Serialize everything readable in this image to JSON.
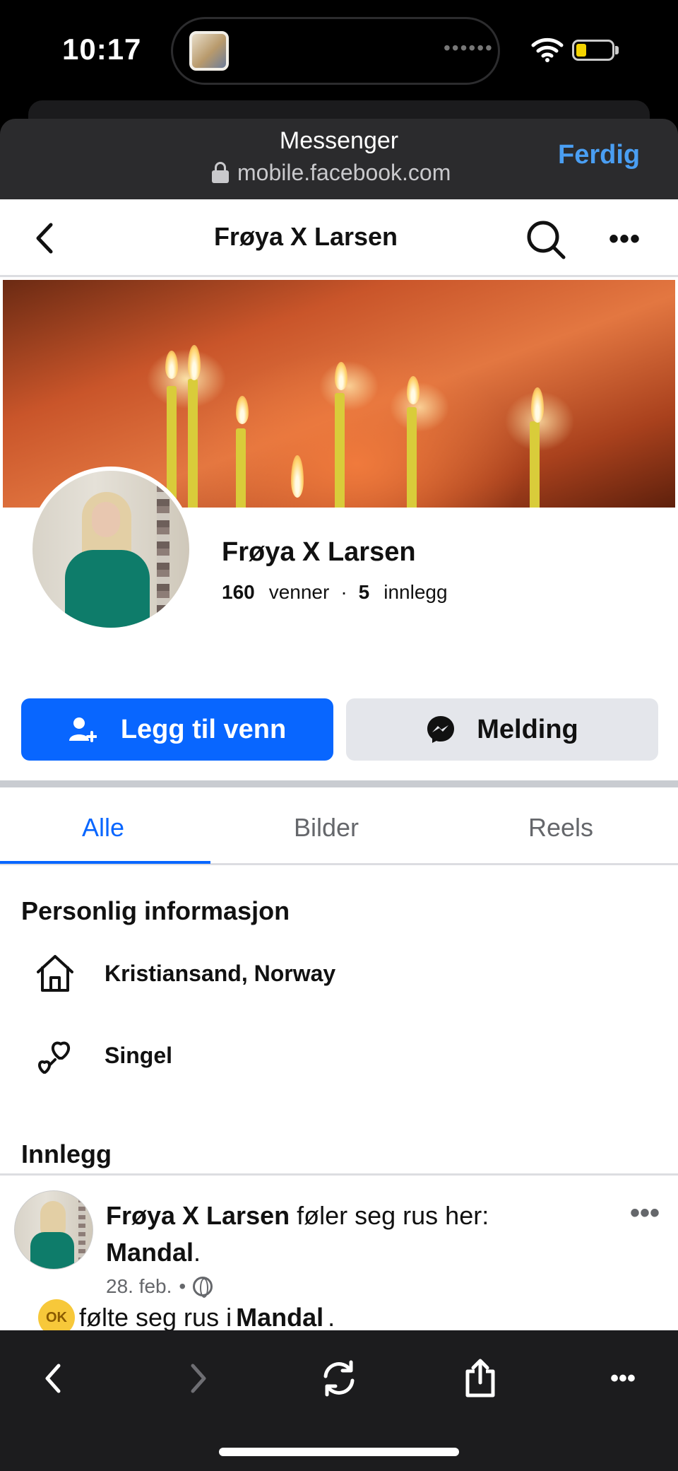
{
  "status_bar": {
    "time": "10:17"
  },
  "browser": {
    "title": "Messenger",
    "url": "mobile.facebook.com",
    "done_label": "Ferdig"
  },
  "nav": {
    "title": "Frøya X Larsen"
  },
  "profile": {
    "name": "Frøya X Larsen",
    "friends_count": "160",
    "friends_label": "venner",
    "separator": "·",
    "posts_count": "5",
    "posts_label": "innlegg"
  },
  "actions": {
    "add_friend_label": "Legg til venn",
    "message_label": "Melding"
  },
  "tabs": [
    {
      "label": "Alle",
      "active": true
    },
    {
      "label": "Bilder",
      "active": false
    },
    {
      "label": "Reels",
      "active": false
    }
  ],
  "personal_info": {
    "title": "Personlig informasjon",
    "items": [
      {
        "icon": "home-icon",
        "text": "Kristiansand, Norway"
      },
      {
        "icon": "hearts-icon",
        "text": "Singel"
      }
    ]
  },
  "posts": {
    "title": "Innlegg",
    "items": [
      {
        "author": "Frøya X Larsen",
        "action": " føler seg rus her:",
        "place": "Mandal",
        "place_suffix": ".",
        "date": "28. feb.",
        "meta_sep": "•",
        "audience_icon": "globe-icon",
        "feeling_emoji": "OK",
        "feeling_text": "følte seg rus i ",
        "feeling_place": "Mandal",
        "feeling_suffix": "."
      }
    ]
  },
  "colors": {
    "brand_blue": "#0866ff",
    "browser_accent": "#4a9ef2",
    "toolbar_bg": "#1c1c1e"
  }
}
